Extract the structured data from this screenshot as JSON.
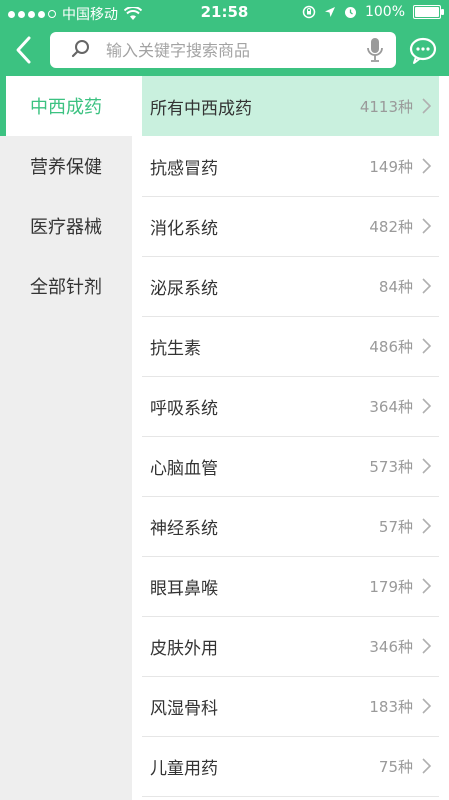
{
  "status": {
    "carrier": "中国移动",
    "time": "21:58",
    "battery": "100%"
  },
  "search": {
    "placeholder": "输入关键字搜索商品"
  },
  "sidebar": {
    "items": [
      {
        "label": "中西成药",
        "active": true
      },
      {
        "label": "营养保健",
        "active": false
      },
      {
        "label": "医疗器械",
        "active": false
      },
      {
        "label": "全部针剂",
        "active": false
      }
    ]
  },
  "list": {
    "items": [
      {
        "label": "所有中西成药",
        "count": "4113种"
      },
      {
        "label": "抗感冒药",
        "count": "149种"
      },
      {
        "label": "消化系统",
        "count": "482种"
      },
      {
        "label": "泌尿系统",
        "count": "84种"
      },
      {
        "label": "抗生素",
        "count": "486种"
      },
      {
        "label": "呼吸系统",
        "count": "364种"
      },
      {
        "label": "心脑血管",
        "count": "573种"
      },
      {
        "label": "神经系统",
        "count": "57种"
      },
      {
        "label": "眼耳鼻喉",
        "count": "179种"
      },
      {
        "label": "皮肤外用",
        "count": "346种"
      },
      {
        "label": "风湿骨科",
        "count": "183种"
      },
      {
        "label": "儿童用药",
        "count": "75种"
      }
    ]
  },
  "colors": {
    "accent": "#3cc281",
    "highlight": "#c9f0de",
    "sidebar_bg": "#eeeeee"
  }
}
